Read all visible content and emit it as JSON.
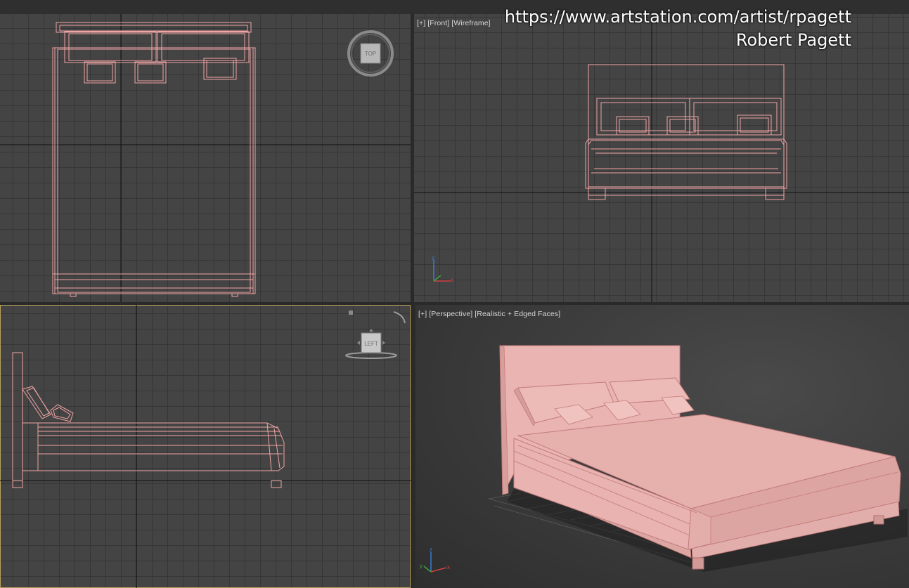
{
  "watermark": {
    "url": "https://www.artstation.com/artist/rpagett",
    "author": "Robert Pagett"
  },
  "viewports": {
    "top": {
      "nav_cube": "TOP"
    },
    "front": {
      "label": [
        "[+]",
        "[Front]",
        "[Wireframe]"
      ]
    },
    "left": {
      "nav_cube": "LEFT"
    },
    "perspective": {
      "label": [
        "[+]",
        "[Perspective]",
        "[Realistic + Edged Faces]"
      ]
    }
  },
  "axis_labels": {
    "z": "z",
    "x": "x",
    "y": "y"
  },
  "colors": {
    "wire": "#f0a5a5",
    "grid": "#444444",
    "gridline": "#363636",
    "active_border": "#b9a25c",
    "mesh": "#e8b0ae"
  }
}
